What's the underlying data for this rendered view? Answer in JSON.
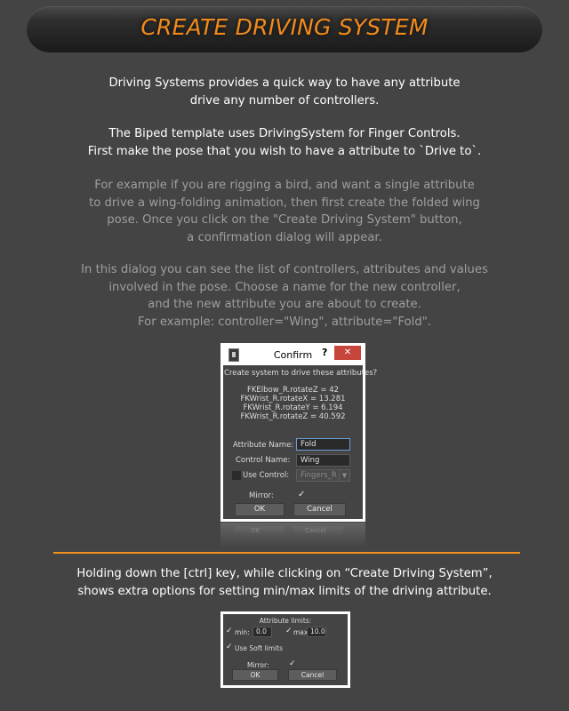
{
  "header": {
    "title": "CREATE DRIVING SYSTEM"
  },
  "intro": {
    "p1": [
      "Driving Systems provides a quick way to have any attribute",
      "drive any number of controllers."
    ],
    "p2": [
      "The Biped template uses DrivingSystem for Finger Controls.",
      "First make the pose that you wish to have a attribute to `Drive to`."
    ],
    "p3": [
      "For example if you are rigging a bird, and want a single attribute",
      "to drive a wing-folding animation, then first create the folded wing",
      "pose. Once you click on the \"Create Driving System\" button,",
      "a confirmation dialog will appear."
    ],
    "p4": [
      "In this dialog you can see the list of controllers, attributes and values",
      "involved in the pose. Choose a name for the new controller,",
      "and the new attribute you are about to create.",
      "For example: controller=\"Wing\", attribute=\"Fold\"."
    ]
  },
  "confirm_dialog": {
    "title": "Confirm",
    "help_label": "?",
    "close_label": "✕",
    "prompt": "Create system to drive these attributes?",
    "attributes": [
      "FKElbow_R.rotateZ = 42",
      "FKWrist_R.rotateX = 13.281",
      "FKWrist_R.rotateY = 6.194",
      "FKWrist_R.rotateZ = 40.592"
    ],
    "attribute_name_label": "Attribute Name:",
    "attribute_name_value": "Fold",
    "control_name_label": "Control Name:",
    "control_name_value": "Wing",
    "use_control_label": "Use Control:",
    "use_control_value": "Fingers_R",
    "mirror_label": "Mirror:",
    "ok_label": "OK",
    "cancel_label": "Cancel",
    "reflection_ok": "OK",
    "reflection_cancel": "Cancel"
  },
  "ctrl_note": [
    "Holding down the [ctrl] key, while clicking on “Create Driving System”,",
    "shows extra options for setting min/max limits of the driving attribute."
  ],
  "limits_dialog": {
    "title": "Attribute limits:",
    "min_label": "min:",
    "min_value": "0.0",
    "max_label": "max",
    "max_value": "10.0",
    "soft_limits_label": "Use Soft limits",
    "mirror_label": "Mirror:",
    "ok_label": "OK",
    "cancel_label": "Cancel"
  },
  "colors": {
    "accent": "#f08a1c",
    "background": "#444444",
    "close_button": "#c7463b"
  }
}
